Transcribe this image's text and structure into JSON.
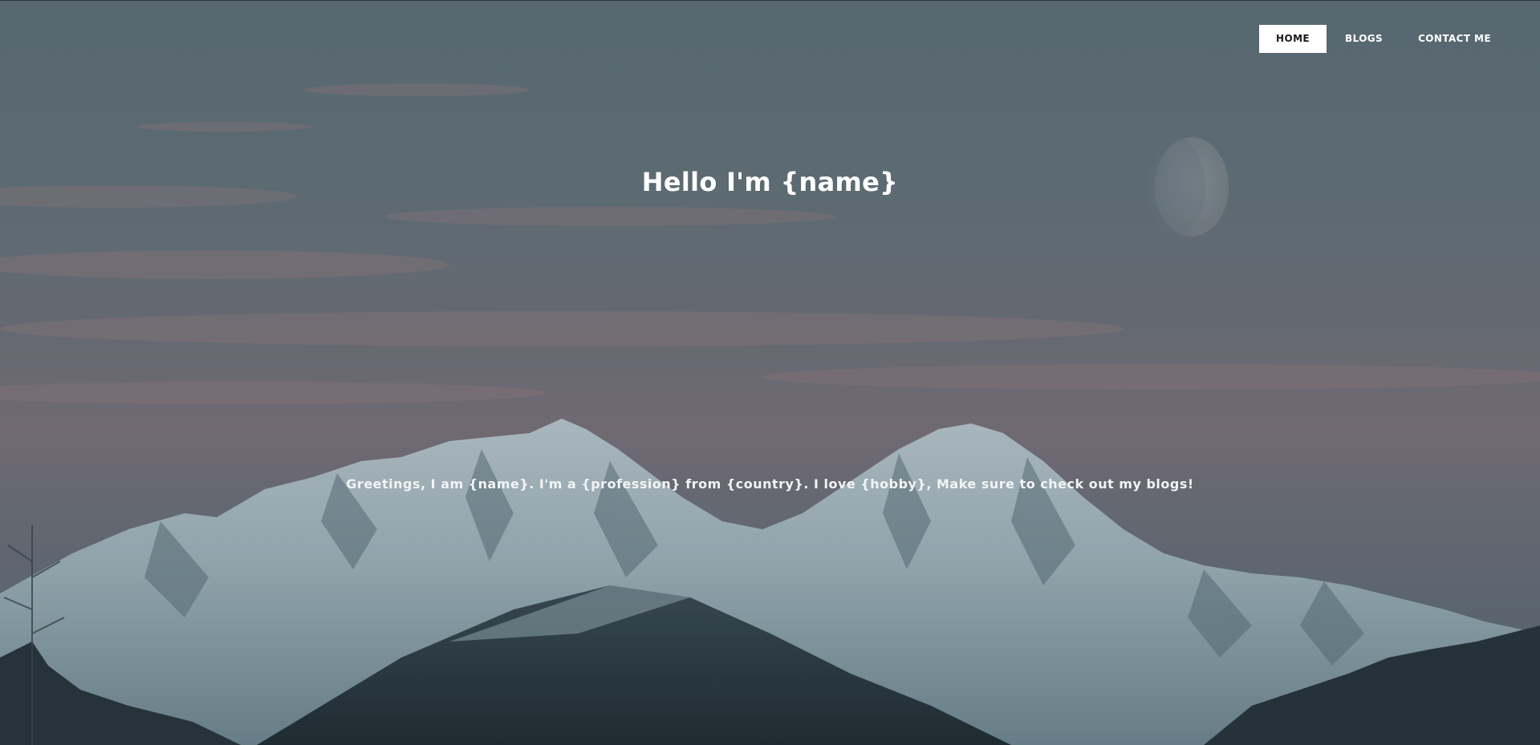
{
  "nav": {
    "items": [
      {
        "label": "HOME",
        "active": true
      },
      {
        "label": "BLOGS",
        "active": false
      },
      {
        "label": "CONTACT ME",
        "active": false
      }
    ]
  },
  "hero": {
    "title": "Hello I'm {name}",
    "subtitle": "Greetings, I am {name}. I'm a {profession} from {country}. I love {hobby}, Make sure to check out my blogs!"
  },
  "colors": {
    "nav_active_bg": "#ffffff",
    "nav_active_text": "#1a1a1a",
    "text": "#ffffff"
  }
}
